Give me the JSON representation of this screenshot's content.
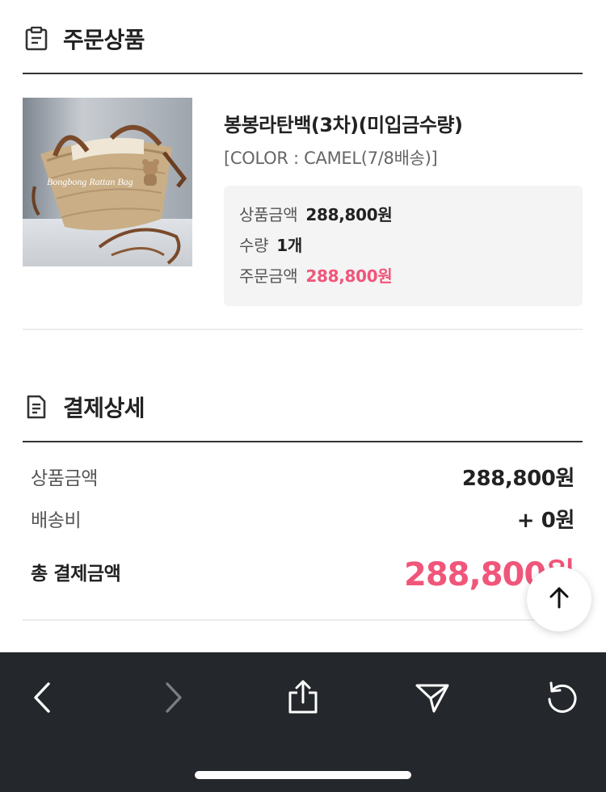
{
  "order_section": {
    "title": "주문상품",
    "icon": "clipboard-icon"
  },
  "product": {
    "name": "봉봉라탄백(3차)(미입금수량)",
    "option": "[COLOR : CAMEL(7/8배송)]",
    "image_caption": "Bongbong Rattan Bag",
    "price_label": "상품금액",
    "price_value": "288,800원",
    "qty_label": "수량",
    "qty_value": "1개",
    "order_label": "주문금액",
    "order_value": "288,800원"
  },
  "payment_section": {
    "title": "결제상세",
    "icon": "receipt-icon",
    "rows": [
      {
        "label": "상품금액",
        "value": "288,800원"
      },
      {
        "label": "배송비",
        "value": "+ 0원"
      },
      {
        "label": "총 결제금액",
        "value": "288,800원"
      }
    ]
  },
  "toolbar": {
    "buttons": [
      "back-icon",
      "forward-icon",
      "share-icon",
      "send-icon",
      "reload-icon"
    ]
  },
  "colors": {
    "accent": "#f0567a",
    "toolbar_bg": "#24272b",
    "price_box_bg": "#f4f4f4"
  }
}
